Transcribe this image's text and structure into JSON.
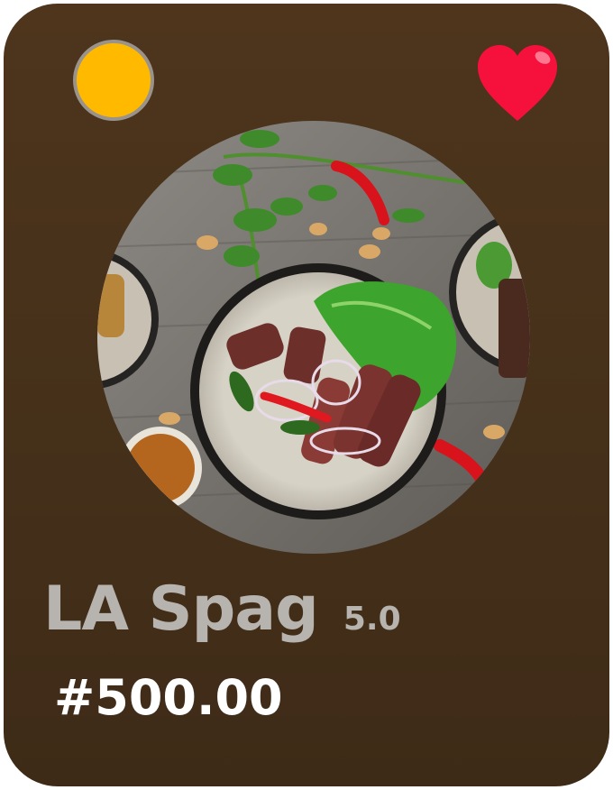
{
  "card": {
    "dish_name": "LA Spag",
    "rating": "5.0",
    "price": "#500.00",
    "image_alt": "dish-photo",
    "favorite_icon": "heart-icon",
    "status_icon": "status-dot-icon"
  },
  "colors": {
    "card_background": "#45301a",
    "title_text": "#b7b4b0",
    "price_text": "#ffffff",
    "status_dot": "#ffba00",
    "heart": "#f5113c"
  }
}
